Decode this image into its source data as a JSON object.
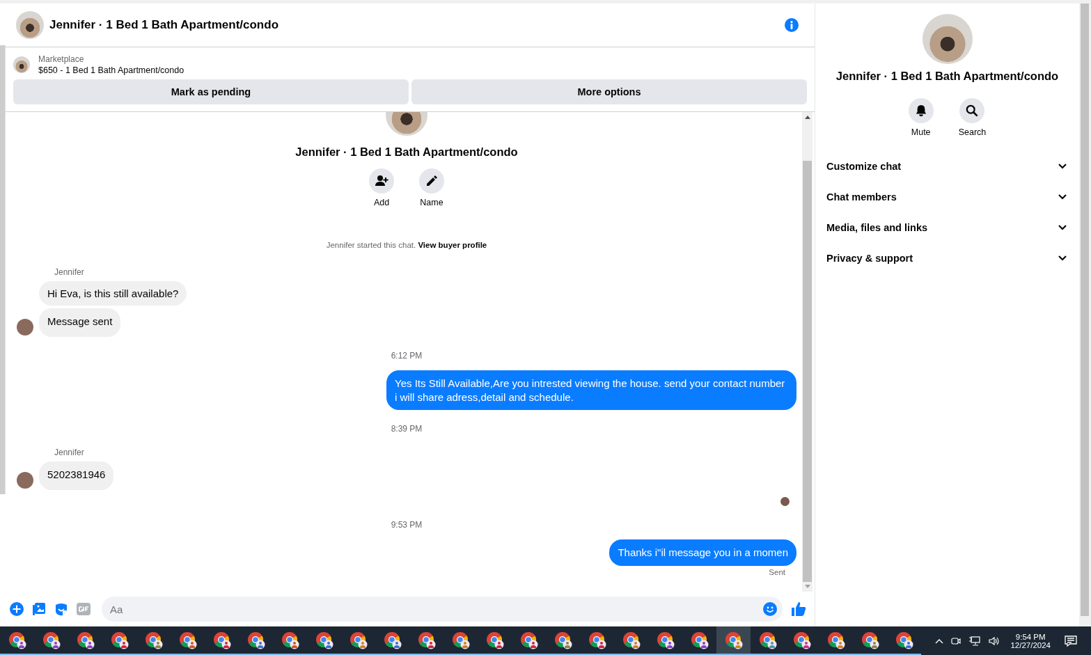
{
  "header": {
    "title": "Jennifer · 1 Bed 1 Bath Apartment/condo"
  },
  "listing": {
    "source": "Marketplace",
    "title": "$650 - 1 Bed 1 Bath Apartment/condo",
    "buttons": [
      "Mark as pending",
      "More options"
    ]
  },
  "profile": {
    "title": "Jennifer · 1 Bed 1 Bath Apartment/condo",
    "actions": [
      {
        "kind": "add",
        "label": "Add"
      },
      {
        "kind": "name",
        "label": "Name"
      }
    ]
  },
  "started": {
    "text": "Jennifer started this chat.",
    "link": "View buyer profile"
  },
  "messages": [
    {
      "kind": "sender",
      "text": "Jennifer"
    },
    {
      "kind": "incoming",
      "text": "Hi Eva, is this still available?",
      "avatar": false
    },
    {
      "kind": "incoming",
      "text": "Message sent",
      "avatar": true
    },
    {
      "kind": "time",
      "text": "6:12 PM"
    },
    {
      "kind": "outgoing",
      "text": "Yes Its Still Available,Are you intrested viewing the house. send your contact number i will share adress,detail and schedule."
    },
    {
      "kind": "time",
      "text": "8:39 PM"
    },
    {
      "kind": "sender",
      "text": "Jennifer"
    },
    {
      "kind": "incoming",
      "text": "5202381946",
      "avatar": true
    },
    {
      "kind": "seen"
    },
    {
      "kind": "time",
      "text": "9:53 PM"
    },
    {
      "kind": "outgoing",
      "text": "Thanks i\"il message you in a momen"
    },
    {
      "kind": "status",
      "text": "Sent"
    }
  ],
  "composer": {
    "placeholder": "Aa"
  },
  "side": {
    "title": "Jennifer · 1 Bed 1 Bath Apartment/condo",
    "actions": [
      {
        "kind": "mute",
        "label": "Mute"
      },
      {
        "kind": "search",
        "label": "Search"
      }
    ],
    "sections": [
      {
        "label": "Customize chat",
        "expanded": false
      },
      {
        "label": "Chat members",
        "expanded": false
      },
      {
        "label": "Media, files and links",
        "expanded": false
      },
      {
        "label": "Privacy & support",
        "expanded": false
      }
    ]
  },
  "taskbar": {
    "apps": [
      {
        "color": "#8a3fc7",
        "selected": false
      },
      {
        "color": "#8a3fc7",
        "selected": false
      },
      {
        "color": "#8a3fc7",
        "selected": false
      },
      {
        "color": "#d8203a",
        "selected": false
      },
      {
        "color": "#8c8440",
        "selected": false
      },
      {
        "color": "#d4551a",
        "selected": false
      },
      {
        "color": "#d8203a",
        "selected": false
      },
      {
        "color": "#3a6fd0",
        "selected": false
      },
      {
        "color": "#d4551a",
        "selected": false
      },
      {
        "color": "#3a6fd0",
        "selected": false
      },
      {
        "color": "#d4801a",
        "selected": false
      },
      {
        "color": "#3a6fd0",
        "selected": false
      },
      {
        "color": "#d8203a",
        "selected": false
      },
      {
        "color": "#d4801a",
        "selected": false
      },
      {
        "color": "#d8203a",
        "selected": false
      },
      {
        "color": "#d8203a",
        "selected": false
      },
      {
        "color": "#8c8440",
        "selected": false
      },
      {
        "color": "#d8203a",
        "selected": false
      },
      {
        "color": "#d4801a",
        "selected": false
      },
      {
        "color": "#8a3fc7",
        "selected": false
      },
      {
        "color": "#8a3fc7",
        "selected": false
      },
      {
        "color": "#d4801a",
        "selected": true
      },
      {
        "color": "#3f9aa0",
        "selected": false
      },
      {
        "color": "#d02a8a",
        "selected": false
      },
      {
        "color": "#d4801a",
        "selected": false
      },
      {
        "color": "#8c8440",
        "selected": false
      },
      {
        "color": "#3a6fd0",
        "selected": false
      }
    ],
    "time": "9:54 PM",
    "date": "12/27/2024"
  }
}
